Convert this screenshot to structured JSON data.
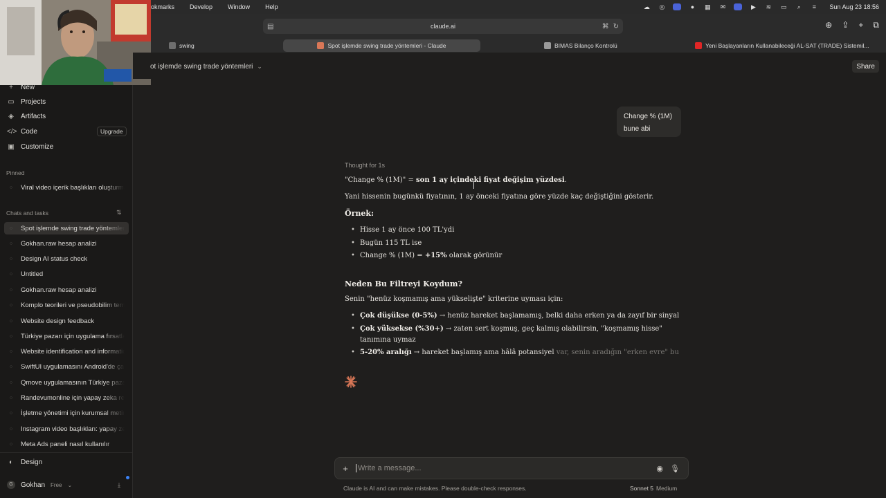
{
  "menubar": {
    "items": [
      "okmarks",
      "Develop",
      "Window",
      "Help"
    ],
    "clock": "Sun Aug 23  18:56"
  },
  "browser": {
    "url": "claude.ai"
  },
  "tabs": [
    {
      "label": "swing",
      "favicon_color": "#7a7a7a"
    },
    {
      "label": "Spot işlemde swing trade yöntemleri - Claude",
      "favicon_color": "#d97757",
      "active": true
    },
    {
      "label": "BIMAS Bilanço Kontrolü",
      "favicon_color": "#9a9a9a"
    },
    {
      "label": "Yeni Başlayanların Kullanabileceği AL-SAT (TRADE) Sistemil...",
      "favicon_color": "#e02626"
    }
  ],
  "header": {
    "title": "ot işlemde swing trade yöntemleri",
    "share_label": "Share"
  },
  "sidebar": {
    "nav": [
      {
        "label": "New",
        "icon": "plus-icon"
      },
      {
        "label": "Projects",
        "icon": "folder-icon"
      },
      {
        "label": "Artifacts",
        "icon": "artifacts-icon"
      },
      {
        "label": "Code",
        "icon": "code-icon"
      },
      {
        "label": "Customize",
        "icon": "customize-icon"
      }
    ],
    "upgrade_label": "Upgrade",
    "pinned_label": "Pinned",
    "pinned": [
      "Viral video içerik başlıkları oluşturma"
    ],
    "chats_label": "Chats and tasks",
    "chats": [
      "Spot işlemde swing trade yöntemleri",
      "Gokhan.raw hesap analizi",
      "Design AI status check",
      "Untitled",
      "Gokhan.raw hesap analizi",
      "Komplo teorileri ve pseudobilim temaları",
      "Website design feedback",
      "Türkiye pazarı için uygulama fırsatları",
      "Website identification and information",
      "SwiftUI uygulamasını Android'de çalıştırma",
      "Qmove uygulamasının Türkiye pazarı",
      "Randevumonline için yapay zeka reklam",
      "İşletme yönetimi için kurumsal metin",
      "Instagram video başlıkları: yapay zeka",
      "Meta Ads paneli nasıl kullanılır"
    ],
    "design_label": "Design",
    "user": {
      "initial": "G",
      "name": "Gokhan",
      "plan": "Free"
    }
  },
  "conversation": {
    "user_message_line1": "Change % (1M)",
    "user_message_line2": "bune abi",
    "thought": "Thought for 1s",
    "p1_pre": "\"Change % (1M)\" = ",
    "p1_bold": "son 1 ay içindeki fiyat değişim yüzdesi",
    "p1_post": ".",
    "p2": "Yani hissenin bugünkü fiyatının, 1 ay önceki fiyatına göre yüzde kaç değiştiğini gösterir.",
    "example_heading": "Örnek:",
    "example_bullets": [
      "Hisse 1 ay önce 100 TL'ydi",
      "Bugün 115 TL ise"
    ],
    "example_bullet3_pre": "Change % (1M) = ",
    "example_bullet3_bold": "+15%",
    "example_bullet3_post": " olarak görünür",
    "section_heading": "Neden Bu Filtreyi Koydum?",
    "section_intro": "Senin \"henüz koşmamış ama yükselişte\" kriterine uyması için:",
    "reason1_bold": "Çok düşükse (0-5%)",
    "reason1_rest": " → henüz hareket başlamamış, belki daha erken ya da zayıf bir sinyal",
    "reason2_bold": "Çok yüksekse (%30+)",
    "reason2_rest_line1": " → zaten sert koşmuş, geç kalmış olabilirsin, \"koşmamış hisse\"",
    "reason2_rest_line2": "tanımına uymaz",
    "reason3_bold": "5-20% aralığı",
    "reason3_rest": " → hareket başlamış ama hâlâ potansiyel",
    "reason3_fade": " var, senin aradığın \"erken evre\" bu"
  },
  "composer": {
    "placeholder": "Write a message...",
    "disclaimer": "Claude is AI and can make mistakes. Please double-check responses.",
    "model": "Sonnet 5",
    "effort": "Medium"
  },
  "colors": {
    "background": "#1f1e1d",
    "sidebar": "#1a1918",
    "accent": "#d97757"
  }
}
